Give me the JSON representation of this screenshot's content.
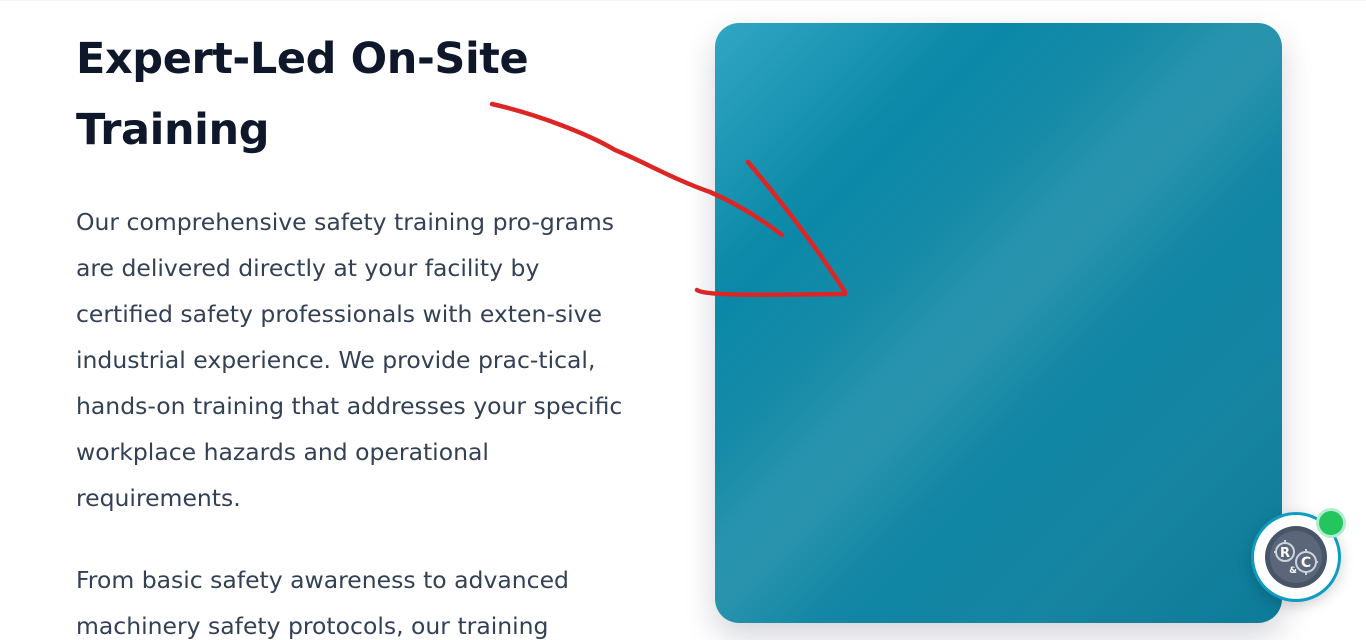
{
  "section": {
    "heading": "Expert-Led On-Site Training",
    "paragraphs": [
      "Our comprehensive safety training pro-grams are delivered directly at your facility by certified safety professionals with exten-sive industrial experience. We provide prac-tical, hands-on training that addresses your specific workplace hazards and operational requirements.",
      "From basic safety awareness to advanced machinery safety protocols, our training"
    ]
  },
  "media": {
    "gradient_colors": [
      "#1a9cbd",
      "#0b89a8",
      "#1f8ea9",
      "#0c7a98"
    ]
  },
  "annotation": {
    "color": "#dc2626",
    "icon": "hand-drawn-arrow"
  },
  "chat_widget": {
    "logo_letters": [
      "R",
      "&",
      "C"
    ],
    "status": "online",
    "status_color": "#22c55e",
    "ring_color": "#0e9cc0"
  }
}
